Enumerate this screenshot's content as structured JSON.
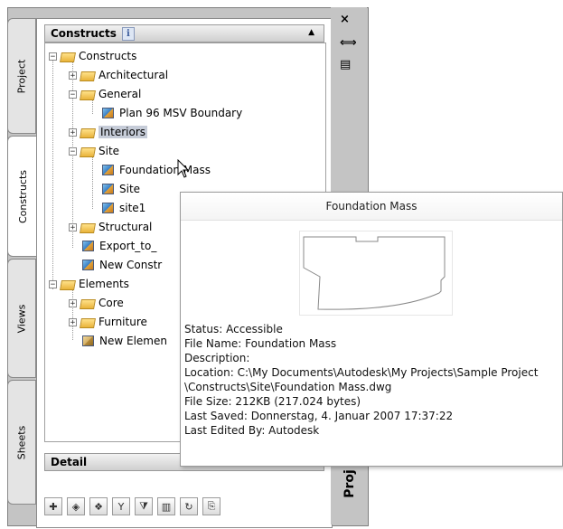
{
  "tabs": [
    {
      "label": "Project",
      "active": false
    },
    {
      "label": "Constructs",
      "active": true
    },
    {
      "label": "Views",
      "active": false
    },
    {
      "label": "Sheets",
      "active": false
    }
  ],
  "constructs_header": {
    "title": "Constructs",
    "info_badge": "i"
  },
  "tree": [
    {
      "label": "Constructs",
      "type": "folder",
      "expander": "−"
    },
    {
      "label": "Architectural",
      "type": "folder",
      "expander": "+"
    },
    {
      "label": "General",
      "type": "folder",
      "expander": "−"
    },
    {
      "label": "Plan 96 MSV Boundary",
      "type": "construct"
    },
    {
      "label": "Interiors",
      "type": "folder",
      "expander": "+",
      "selected": true
    },
    {
      "label": "Site",
      "type": "folder",
      "expander": "−"
    },
    {
      "label": "Foundation Mass",
      "type": "construct"
    },
    {
      "label": "Site",
      "type": "construct"
    },
    {
      "label": "site1",
      "type": "construct"
    },
    {
      "label": "Structural",
      "type": "folder",
      "expander": "+"
    },
    {
      "label": "Export_to_",
      "type": "construct"
    },
    {
      "label": "New Constr",
      "type": "construct"
    },
    {
      "label": "Elements",
      "type": "folder",
      "expander": "−"
    },
    {
      "label": "Core",
      "type": "folder",
      "expander": "+"
    },
    {
      "label": "Furniture",
      "type": "folder",
      "expander": "+"
    },
    {
      "label": "New Elemen",
      "type": "element"
    }
  ],
  "detail_header": {
    "title": "Detail"
  },
  "controls": {
    "close": "×",
    "autohide": "⟺",
    "properties": "▤"
  },
  "properties_label": "Proj",
  "tooltip": {
    "title": "Foundation Mass",
    "lines": [
      "Status: Accessible",
      "File Name: Foundation Mass",
      "Description:",
      "Location: C:\\My Documents\\Autodesk\\My Projects\\Sample Project",
      "\\Constructs\\Site\\Foundation Mass.dwg",
      "File Size: 212KB (217.024 bytes)",
      "Last Saved: Donnerstag, 4. Januar 2007  17:37:22",
      "Last Edited By: Autodesk"
    ]
  },
  "toolbar_icons": [
    "add-construct-icon",
    "add-element-icon",
    "copy-construct-icon",
    "xref-icon",
    "filter-icon",
    "columns-icon",
    "refresh-icon",
    "repath-icon"
  ],
  "colors": {
    "selection": "#c6ccd8",
    "palette_bg": "#c4c4c4",
    "folder": "#f0c24a",
    "cube_blue": "#3b7fc4"
  }
}
